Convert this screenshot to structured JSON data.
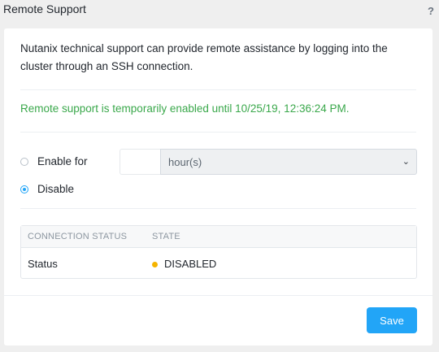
{
  "header": {
    "title": "Remote Support",
    "help_label": "?"
  },
  "panel": {
    "description": "Nutanix technical support can provide remote assistance by logging into the cluster through an SSH connection.",
    "status_message": "Remote support is temporarily enabled until 10/25/19, 12:36:24 PM.",
    "status_color": "#3aa84b",
    "options": {
      "enable_label": "Enable for",
      "disable_label": "Disable",
      "selected": "disable"
    },
    "duration": {
      "value": "",
      "placeholder": "",
      "unit": "hour(s)"
    },
    "connection_table": {
      "headers": [
        "CONNECTION STATUS",
        "STATE"
      ],
      "rows": [
        {
          "name": "Status",
          "state": "DISABLED",
          "state_color": "#f5b400"
        }
      ]
    }
  },
  "footer": {
    "save_label": "Save",
    "accent": "#22a5f7"
  }
}
